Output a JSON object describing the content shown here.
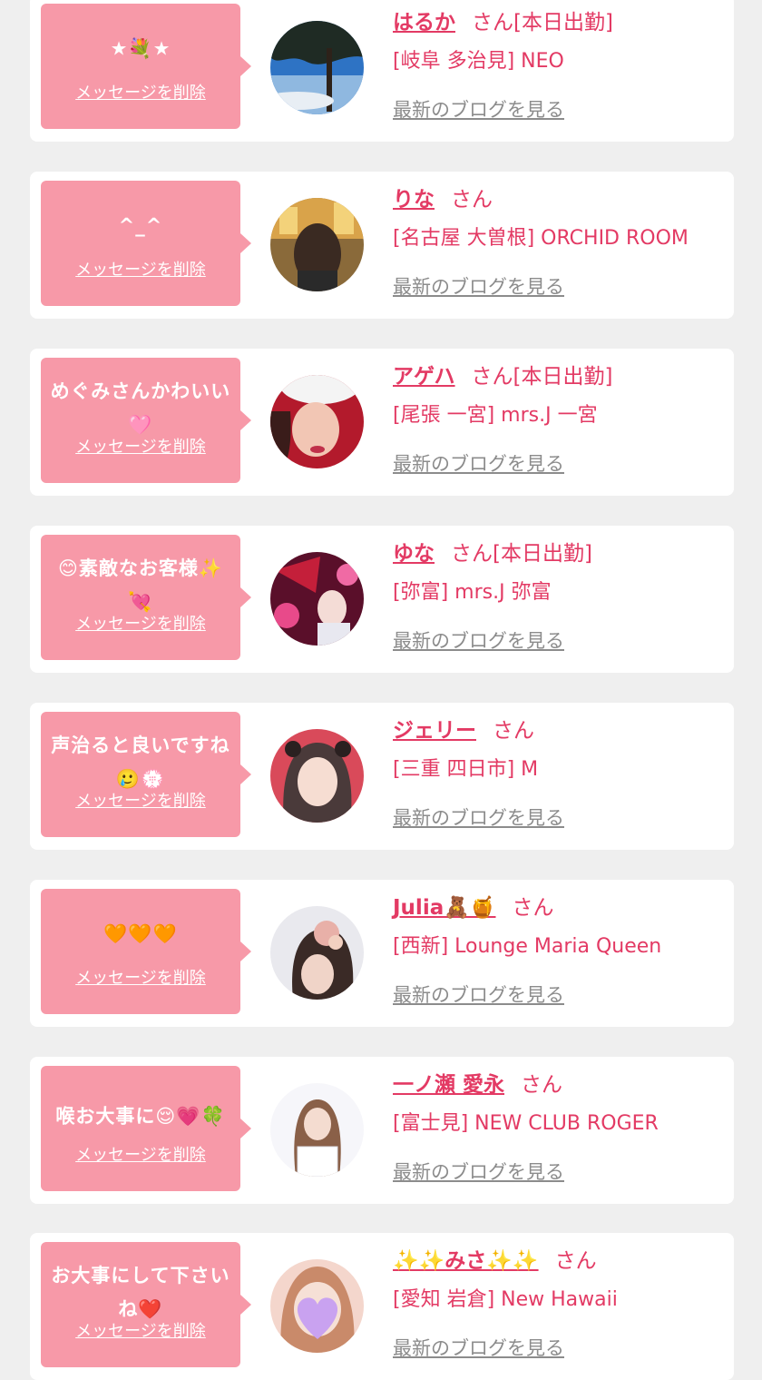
{
  "common": {
    "delete_label": "メッセージを削除",
    "san_suffix": "さん",
    "blog_link": "最新のブログを見る"
  },
  "colors": {
    "accent": "#e33a64",
    "bubble": "#f799a8",
    "background": "#efefef"
  },
  "cards": [
    {
      "message": "★💐★",
      "name": "はるか",
      "status": "[本日出勤]",
      "shop": "[岐阜 多治見] NEO",
      "avatar": "avatar-photo"
    },
    {
      "message": "^_^",
      "name": "りな",
      "status": "",
      "shop": "[名古屋 大曽根] ORCHID ROOM",
      "avatar": "avatar-photo"
    },
    {
      "message": "めぐみさんかわいい🩷",
      "name": "アゲハ",
      "status": "[本日出勤]",
      "shop": "[尾張 一宮] mrs.J 一宮",
      "avatar": "avatar-photo"
    },
    {
      "message": "😊素敵なお客様✨💘",
      "name": "ゆな",
      "status": "[本日出勤]",
      "shop": "[弥富] mrs.J 弥富",
      "avatar": "avatar-photo"
    },
    {
      "message": "声治ると良いですね🥲💮",
      "name": "ジェリー",
      "status": "",
      "shop": "[三重 四日市] M",
      "avatar": "avatar-photo"
    },
    {
      "message": "🧡🧡🧡",
      "name": "Julia🧸🍯",
      "status": "",
      "shop": "[西新] Lounge Maria Queen",
      "avatar": "avatar-photo"
    },
    {
      "message": "喉お大事に😌💗🍀",
      "name": "一ノ瀬 愛永",
      "status": "",
      "shop": "[富士見] NEW CLUB ROGER",
      "avatar": "avatar-photo"
    },
    {
      "message": "お大事にして下さいね❤️",
      "name": "✨✨みさ✨✨",
      "status": "",
      "shop": "[愛知 岩倉] New Hawaii",
      "avatar": "avatar-photo"
    }
  ]
}
